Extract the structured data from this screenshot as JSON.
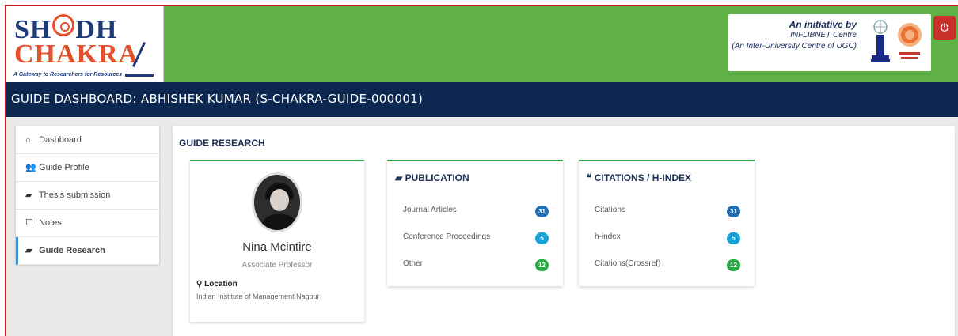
{
  "logo": {
    "line1_a": "SH",
    "line1_b": "DH",
    "line2": "CHAKRA",
    "tagline": "A Gateway to Researchers for Resources"
  },
  "initiative": {
    "line1": "An initiative by",
    "line2": "INFLIBNET Centre",
    "line3": "(An Inter-University Centre of UGC)"
  },
  "power_icon": "power-icon",
  "title_bar": "GUIDE DASHBOARD: ABHISHEK KUMAR (S-CHAKRA-GUIDE-000001)",
  "sidebar": {
    "items": [
      {
        "icon": "home-icon",
        "glyph": "⌂",
        "label": "Dashboard"
      },
      {
        "icon": "users-icon",
        "glyph": "👥",
        "label": "Guide Profile"
      },
      {
        "icon": "book-icon",
        "glyph": "▰",
        "label": "Thesis submission"
      },
      {
        "icon": "file-icon",
        "glyph": "☐",
        "label": "Notes"
      },
      {
        "icon": "book-icon",
        "glyph": "▰",
        "label": "Guide Research"
      }
    ]
  },
  "main": {
    "section_title": "GUIDE RESEARCH",
    "profile": {
      "name": "Nina Mcintire",
      "role": "Associate Professor",
      "location_label": "Location",
      "location_value": "Indian Institute of Management Nagpur"
    },
    "publication": {
      "title": "PUBLICATION",
      "rows": [
        {
          "label": "Journal Articles",
          "value": "31",
          "color": "#1f6fb2"
        },
        {
          "label": "Conference Proceedings",
          "value": "5",
          "color": "#17a2d6"
        },
        {
          "label": "Other",
          "value": "12",
          "color": "#28a745"
        }
      ]
    },
    "citations": {
      "title": "CITATIONS / H-INDEX",
      "rows": [
        {
          "label": "Citations",
          "value": "31",
          "color": "#1f6fb2"
        },
        {
          "label": "h-index",
          "value": "5",
          "color": "#17a2d6"
        },
        {
          "label": "Citations(Crossref)",
          "value": "12",
          "color": "#28a745"
        }
      ]
    }
  },
  "colors": {
    "header_green": "#5fb146",
    "title_navy": "#0d2850",
    "card_accent": "#2e9e48",
    "power_red": "#c9302c"
  }
}
